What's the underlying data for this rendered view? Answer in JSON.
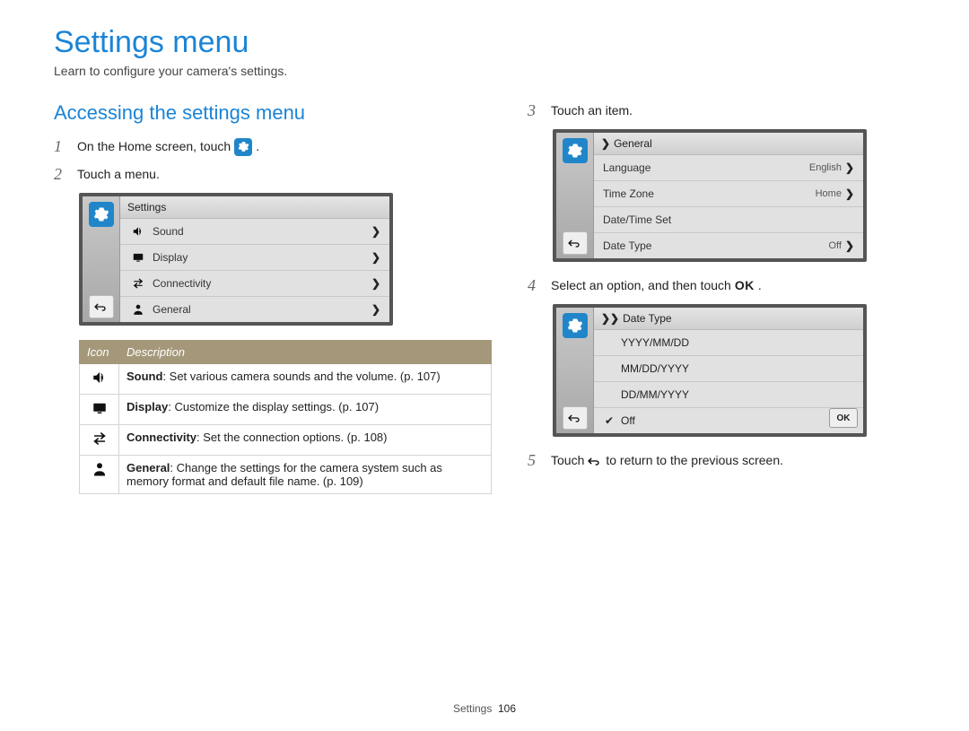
{
  "title": "Settings menu",
  "intro": "Learn to configure your camera's settings.",
  "section_heading": "Accessing the settings menu",
  "steps": {
    "s1": {
      "num": "1",
      "pre": "On the Home screen, touch",
      "post": "."
    },
    "s2": {
      "num": "2",
      "text": "Touch a menu."
    },
    "s3": {
      "num": "3",
      "text": "Touch an item."
    },
    "s4": {
      "num": "4",
      "pre": "Select an option, and then touch",
      "ok": "OK",
      "post": "."
    },
    "s5": {
      "num": "5",
      "pre": "Touch",
      "post": "to return to the previous screen."
    }
  },
  "screen1": {
    "title": "Settings",
    "rows": [
      {
        "label": "Sound"
      },
      {
        "label": "Display"
      },
      {
        "label": "Connectivity"
      },
      {
        "label": "General"
      }
    ]
  },
  "desc_table": {
    "header_icon": "Icon",
    "header_desc": "Description",
    "rows": [
      {
        "bold": "Sound",
        "rest": ": Set various camera sounds and the volume. (p. 107)"
      },
      {
        "bold": "Display",
        "rest": ": Customize the display settings. (p. 107)"
      },
      {
        "bold": "Connectivity",
        "rest": ": Set the connection options. (p. 108)"
      },
      {
        "bold": "General",
        "rest": ": Change the settings for the camera system such as memory format and default file name. (p. 109)"
      }
    ]
  },
  "screen2": {
    "crumb": "General",
    "rows": [
      {
        "label": "Language",
        "value": "English"
      },
      {
        "label": "Time Zone",
        "value": "Home"
      },
      {
        "label": "Date/Time Set",
        "value": ""
      },
      {
        "label": "Date Type",
        "value": "Off"
      }
    ]
  },
  "screen3": {
    "crumb": "Date Type",
    "options": [
      {
        "label": "YYYY/MM/DD",
        "checked": false
      },
      {
        "label": "MM/DD/YYYY",
        "checked": false
      },
      {
        "label": "DD/MM/YYYY",
        "checked": false
      },
      {
        "label": "Off",
        "checked": true
      }
    ],
    "ok": "OK"
  },
  "footer": {
    "section": "Settings",
    "page": "106"
  }
}
